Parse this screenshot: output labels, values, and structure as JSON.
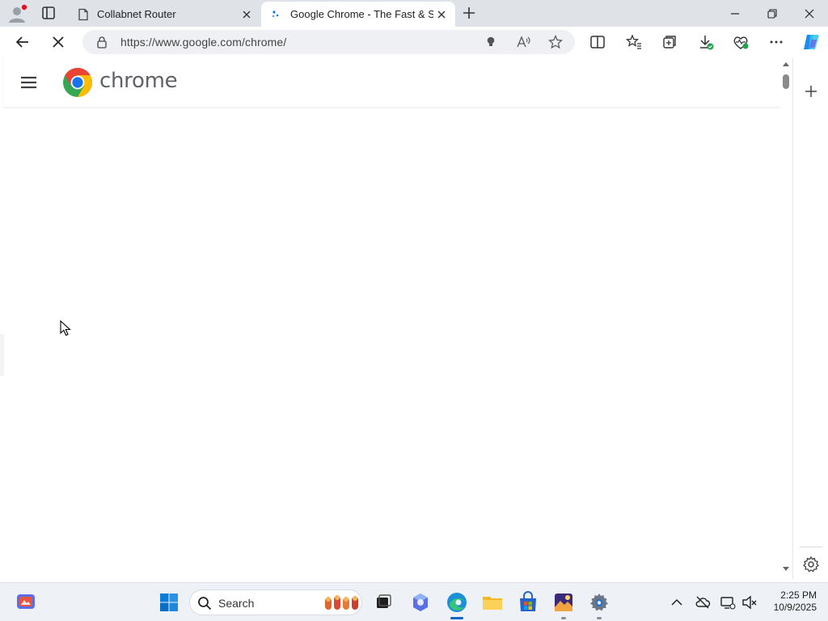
{
  "browser": {
    "tabs": [
      {
        "title": "Collabnet Router",
        "active": false,
        "icon": "page-icon"
      },
      {
        "title": "Google Chrome - The Fast & Sec",
        "active": true,
        "icon": "loading-dots-icon"
      }
    ],
    "address_bar": {
      "url": "https://www.google.com/chrome/"
    },
    "toolbar_icons": [
      "split-screen-icon",
      "favorites-icon",
      "collections-icon",
      "downloads-icon",
      "browser-essentials-icon",
      "more-icon",
      "copilot-icon"
    ]
  },
  "page": {
    "brand_name": "chrome"
  },
  "taskbar": {
    "search_label": "Search",
    "clock_time": "2:25 PM",
    "clock_date": "10/9/2025"
  },
  "colors": {
    "accent": "#0a66c2",
    "chrome_red": "#ea4335",
    "chrome_yellow": "#fbbc04",
    "chrome_green": "#34a853",
    "chrome_blue": "#1a73e8"
  }
}
